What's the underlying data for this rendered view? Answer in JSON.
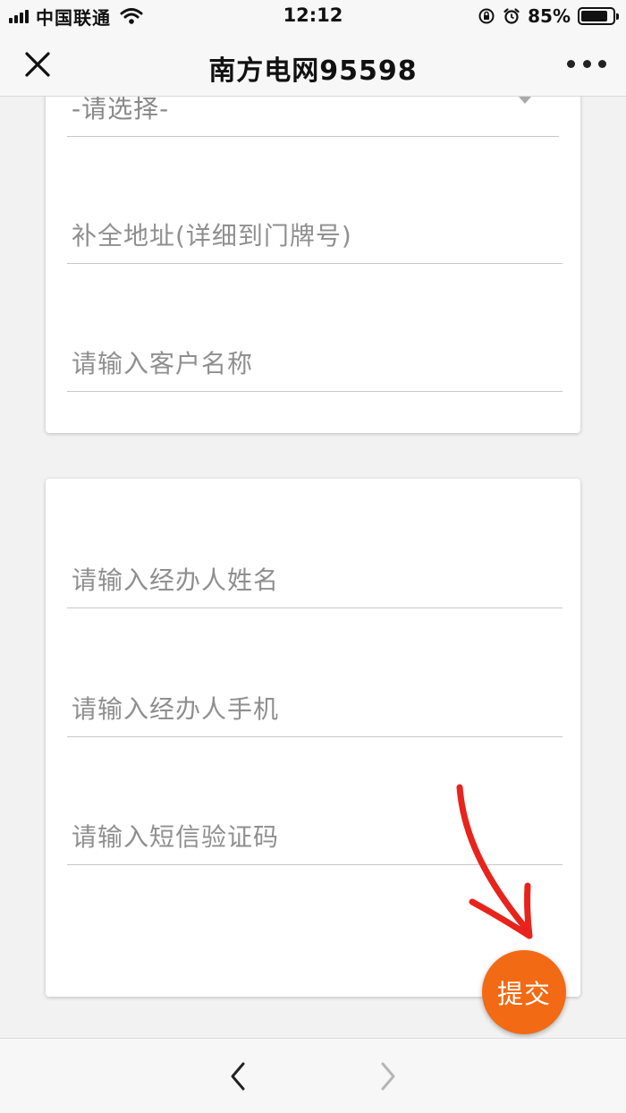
{
  "status_bar": {
    "carrier": "中国联通",
    "time": "12:12",
    "battery": "85%",
    "battery_level": 0.85
  },
  "nav": {
    "title": "南方电网95598"
  },
  "form": {
    "region_select": {
      "value": "-请选择-"
    },
    "address": {
      "placeholder": "补全地址(详细到门牌号)"
    },
    "customer_name": {
      "placeholder": "请输入客户名称"
    },
    "agent_name": {
      "placeholder": "请输入经办人姓名"
    },
    "agent_phone": {
      "placeholder": "请输入经办人手机"
    },
    "sms_code": {
      "placeholder": "请输入短信验证码"
    }
  },
  "submit": {
    "label": "提交"
  },
  "colors": {
    "accent": "#f26a14",
    "annotation": "#e8231c"
  }
}
